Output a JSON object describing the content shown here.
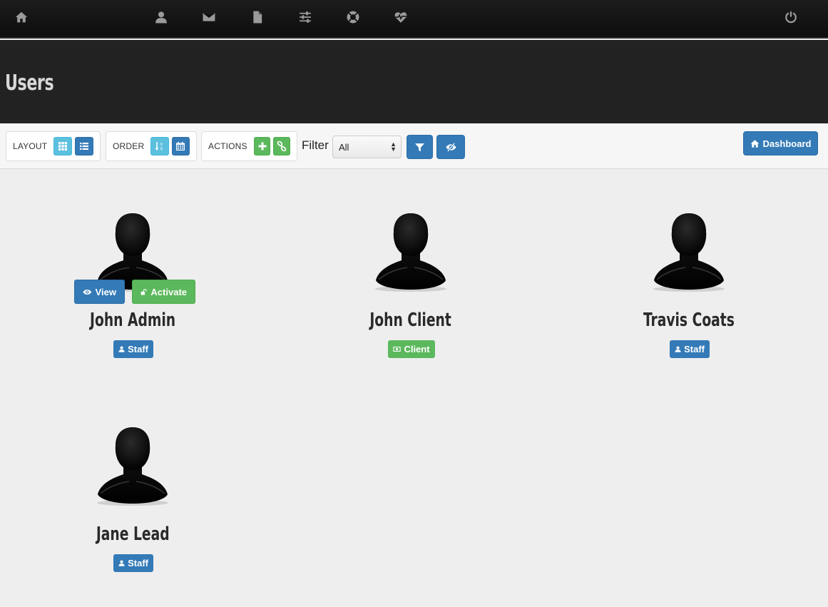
{
  "nav": {
    "icons": [
      "home-icon",
      "user-icon",
      "envelope-icon",
      "file-icon",
      "sliders-icon",
      "lifebuoy-icon",
      "heartbeat-icon",
      "power-icon"
    ]
  },
  "header": {
    "title": "Users"
  },
  "toolbar": {
    "layout_label": "LAYOUT",
    "order_label": "ORDER",
    "actions_label": "ACTIONS",
    "filter_label": "Filter",
    "filter_value": "All",
    "dashboard_label": "Dashboard"
  },
  "users": [
    {
      "name": "John Admin",
      "role": "Staff",
      "view_label": "View",
      "activate_label": "Activate"
    },
    {
      "name": "John Client",
      "role": "Client"
    },
    {
      "name": "Travis Coats",
      "role": "Staff"
    },
    {
      "name": "Jane Lead",
      "role": "Staff"
    }
  ],
  "colors": {
    "primary": "#337ab7",
    "success": "#5cb85c",
    "info": "#5bc0de",
    "nav_bg": "#111111",
    "header_bg": "#222222",
    "page_bg": "#eeeeee"
  }
}
